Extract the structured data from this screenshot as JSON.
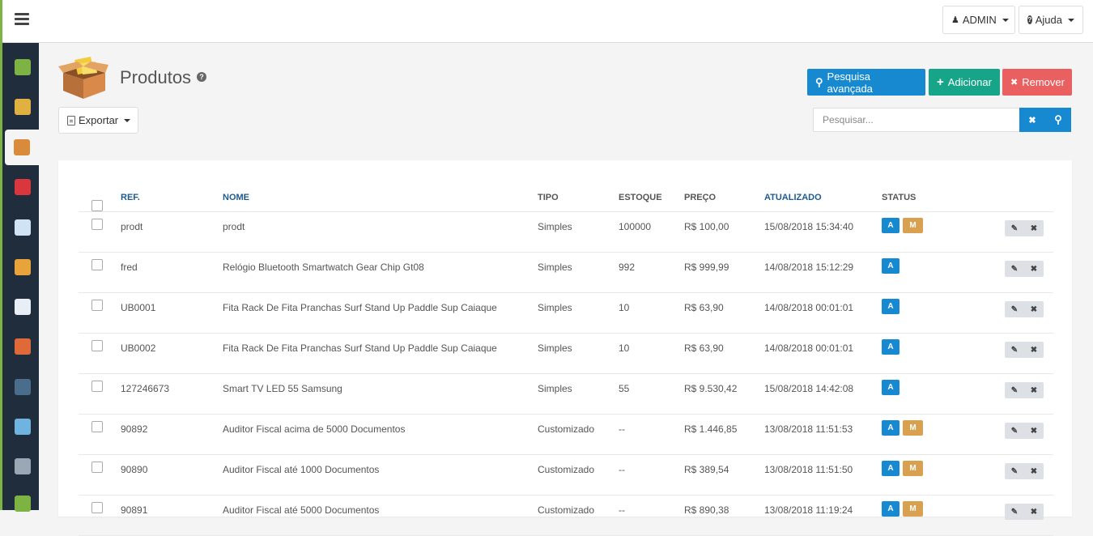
{
  "topbar": {
    "admin_label": "ADMIN",
    "help_label": "Ajuda"
  },
  "page": {
    "title": "Produtos",
    "help_glyph": "?"
  },
  "actions": {
    "advanced_search": "Pesquisa avançada",
    "add": "Adicionar",
    "remove": "Remover",
    "export": "Exportar"
  },
  "search": {
    "placeholder": "Pesquisar...",
    "clear_glyph": "✖",
    "search_glyph": "⚲"
  },
  "table": {
    "headers": {
      "ref": "REF.",
      "nome": "NOME",
      "tipo": "TIPO",
      "estoque": "ESTOQUE",
      "preco": "PREÇO",
      "atualizado": "ATUALIZADO",
      "status": "STATUS"
    },
    "rows": [
      {
        "ref": "prodt",
        "nome": "prodt",
        "tipo": "Simples",
        "estoque": "100000",
        "preco": "R$ 100,00",
        "atualizado": "15/08/2018 15:34:40",
        "badges": [
          "A",
          "M"
        ]
      },
      {
        "ref": "fred",
        "nome": "Relógio Bluetooth Smartwatch Gear Chip Gt08",
        "tipo": "Simples",
        "estoque": "992",
        "preco": "R$ 999,99",
        "atualizado": "14/08/2018 15:12:29",
        "badges": [
          "A"
        ]
      },
      {
        "ref": "UB0001",
        "nome": "Fita Rack De Fita Pranchas Surf Stand Up Paddle Sup Caiaque",
        "tipo": "Simples",
        "estoque": "10",
        "preco": "R$ 63,90",
        "atualizado": "14/08/2018 00:01:01",
        "badges": [
          "A"
        ]
      },
      {
        "ref": "UB0002",
        "nome": "Fita Rack De Fita Pranchas Surf Stand Up Paddle Sup Caiaque",
        "tipo": "Simples",
        "estoque": "10",
        "preco": "R$ 63,90",
        "atualizado": "14/08/2018 00:01:01",
        "badges": [
          "A"
        ]
      },
      {
        "ref": "127246673",
        "nome": "Smart TV LED 55 Samsung",
        "tipo": "Simples",
        "estoque": "55",
        "preco": "R$ 9.530,42",
        "atualizado": "15/08/2018 14:42:08",
        "badges": [
          "A"
        ]
      },
      {
        "ref": "90892",
        "nome": "Auditor Fiscal acima de 5000 Documentos",
        "tipo": "Customizado",
        "estoque": "--",
        "preco": "R$ 1.446,85",
        "atualizado": "13/08/2018 11:51:53",
        "badges": [
          "A",
          "M"
        ]
      },
      {
        "ref": "90890",
        "nome": "Auditor Fiscal até 1000 Documentos",
        "tipo": "Customizado",
        "estoque": "--",
        "preco": "R$ 389,54",
        "atualizado": "13/08/2018 11:51:50",
        "badges": [
          "A",
          "M"
        ]
      },
      {
        "ref": "90891",
        "nome": "Auditor Fiscal até 5000 Documentos",
        "tipo": "Customizado",
        "estoque": "--",
        "preco": "R$ 890,38",
        "atualizado": "13/08/2018 11:19:24",
        "badges": [
          "A",
          "M"
        ]
      }
    ],
    "edit_glyph": "✎",
    "delete_glyph": "✖"
  },
  "sidebar": {
    "items": [
      {
        "icon": "db-icon",
        "color": "#7cb342"
      },
      {
        "icon": "cart-box-icon",
        "color": "#e0b040"
      },
      {
        "icon": "product-box-icon",
        "color": "#d98a3a"
      },
      {
        "icon": "percent-icon",
        "color": "#d9363e"
      },
      {
        "icon": "card-icon",
        "color": "#cfe3f5"
      },
      {
        "icon": "truck-icon",
        "color": "#e8a33a"
      },
      {
        "icon": "document-icon",
        "color": "#e8eef5"
      },
      {
        "icon": "users-icon",
        "color": "#e0693a"
      },
      {
        "icon": "person-icon",
        "color": "#4a6d8c"
      },
      {
        "icon": "image-icon",
        "color": "#6fb3e0"
      },
      {
        "icon": "print-icon",
        "color": "#9aa7b5"
      },
      {
        "icon": "chart-icon",
        "color": "#7cb342"
      }
    ]
  }
}
